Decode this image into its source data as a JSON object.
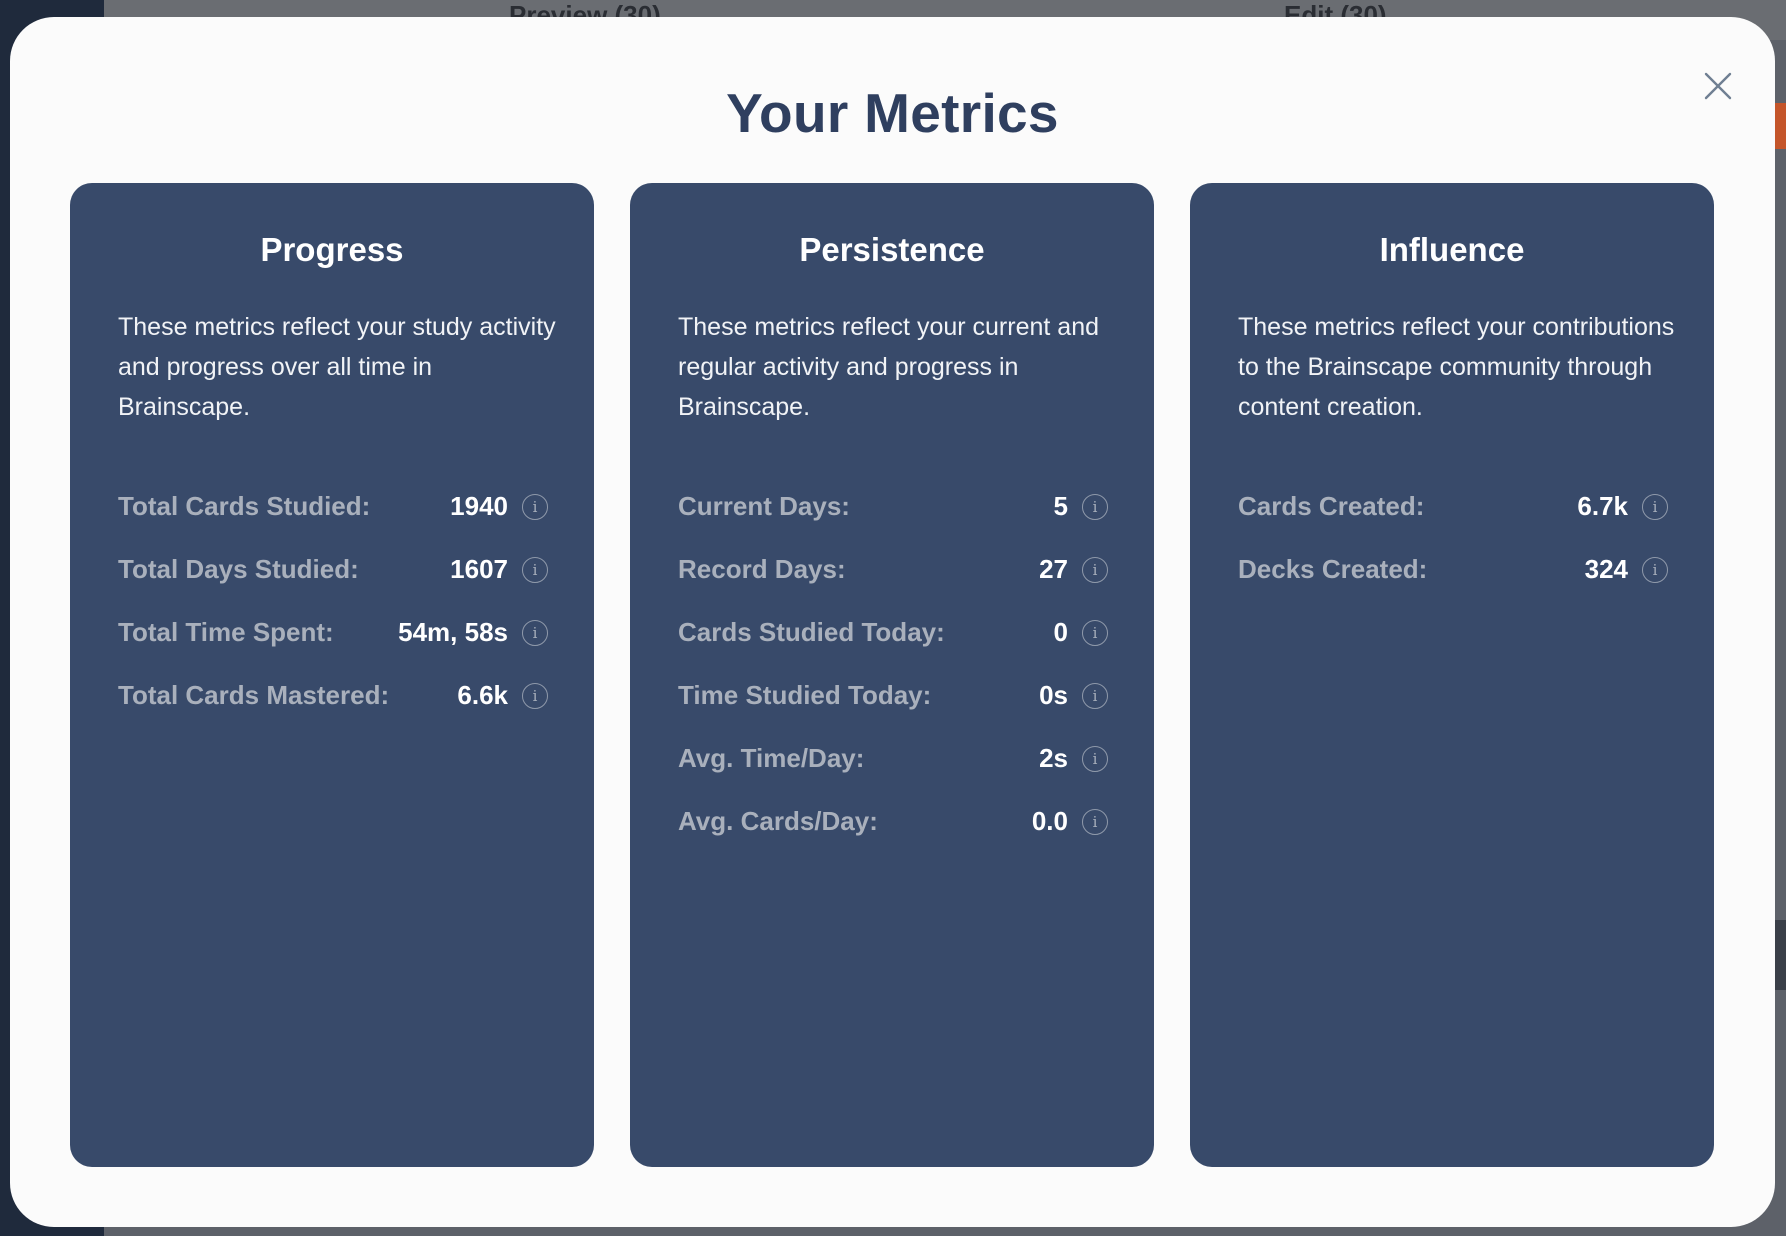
{
  "background": {
    "tabs": [
      "Preview (30)",
      "Edit (30)"
    ]
  },
  "modal": {
    "title": "Your Metrics",
    "close_icon": "close-icon"
  },
  "cards": [
    {
      "title": "Progress",
      "description": "These metrics reflect your study activity and progress over all time in Brainscape.",
      "metrics": [
        {
          "label": "Total Cards Studied:",
          "value": "1940"
        },
        {
          "label": "Total Days Studied:",
          "value": "1607"
        },
        {
          "label": "Total Time Spent:",
          "value": "54m, 58s"
        },
        {
          "label": "Total Cards Mastered:",
          "value": "6.6k"
        }
      ]
    },
    {
      "title": "Persistence",
      "description": "These metrics reflect your current and regular activity and progress in Brainscape.",
      "metrics": [
        {
          "label": "Current Days:",
          "value": "5"
        },
        {
          "label": "Record Days:",
          "value": "27"
        },
        {
          "label": "Cards Studied Today:",
          "value": "0"
        },
        {
          "label": "Time Studied Today:",
          "value": "0s"
        },
        {
          "label": "Avg. Time/Day:",
          "value": "2s"
        },
        {
          "label": "Avg. Cards/Day:",
          "value": "0.0"
        }
      ]
    },
    {
      "title": "Influence",
      "description": "These metrics reflect your contributions to the Brainscape community through content creation.",
      "metrics": [
        {
          "label": "Cards Created:",
          "value": "6.7k"
        },
        {
          "label": "Decks Created:",
          "value": "324"
        }
      ]
    }
  ],
  "info_icon_glyph": "i",
  "colors": {
    "card_bg": "#384a6a",
    "title": "#2f3f5f",
    "label": "#a9b0bc"
  }
}
